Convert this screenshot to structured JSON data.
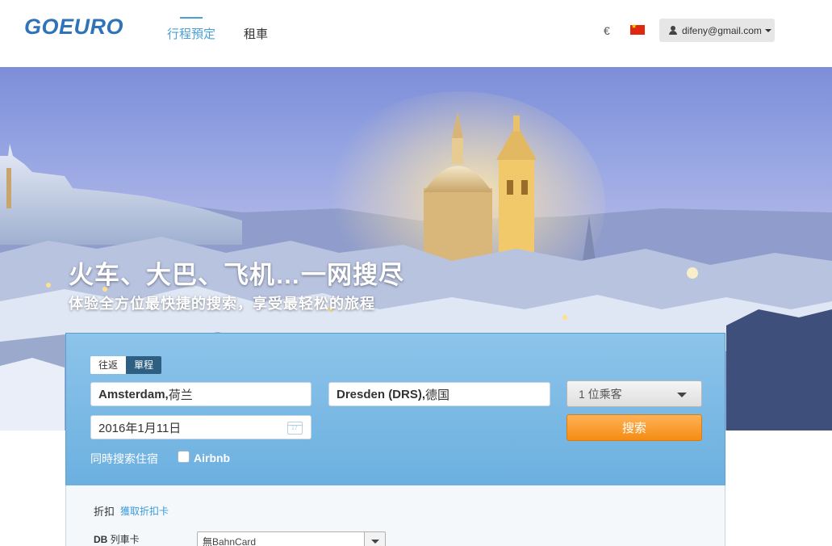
{
  "header": {
    "logo_text": "GOEURO",
    "nav": [
      {
        "label": "行程預定",
        "active": true
      },
      {
        "label": "租車",
        "active": false
      }
    ],
    "currency": "€",
    "flag": "china-flag-icon",
    "user_email": "difeny@gmail.com"
  },
  "hero": {
    "title": "火车、大巴、飞机…一网搜尽",
    "subtitle": "体验全方位最快捷的搜索，享受最轻松的旅程"
  },
  "search": {
    "trip_types": [
      "往返",
      "單程"
    ],
    "selected_trip_type": "單程",
    "from_city": "Amsterdam,",
    "from_country": " 荷兰",
    "to_city": "Dresden (DRS),",
    "to_country": " 德国",
    "date": "2016年1月11日",
    "passengers": "1 位乘客",
    "search_button": "搜索",
    "hotel_label": "同時搜索住宿",
    "airbnb_label": "Airbnb",
    "airbnb_checked": false
  },
  "discount": {
    "label": "折扣",
    "link": "獲取折扣卡",
    "db_label_bold": "DB",
    "db_label_rest": " 列車卡",
    "db_selected": "無BahnCard"
  },
  "colors": {
    "brand": "#2f73b8",
    "accent": "#4aa0d8",
    "search_button": "#f48c14",
    "panel": "#6cb0e0"
  }
}
